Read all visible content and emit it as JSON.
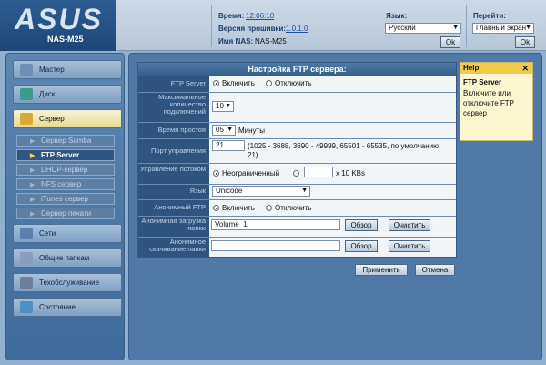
{
  "header": {
    "logo": "ASUS",
    "model": "NAS-M25",
    "time_label": "Время:",
    "time_value": "12:06:10",
    "firmware_label": "Версия прошивки:",
    "firmware_value": "1.0.1.0",
    "nas_name_label": "Имя NAS:",
    "nas_name_value": "NAS-M25",
    "language_label": "Язык:",
    "language_value": "Русский",
    "goto_label": "Перейти:",
    "goto_value": "Главный экран",
    "ok_label": "Ok"
  },
  "nav": {
    "items": [
      {
        "label": "Мастер",
        "icon": "wand-icon"
      },
      {
        "label": "Диск",
        "icon": "disk-icon"
      },
      {
        "label": "Сервер",
        "icon": "server-icon"
      },
      {
        "label": "Сети",
        "icon": "network-icon"
      },
      {
        "label": "Общие папкам",
        "icon": "share-icon"
      },
      {
        "label": "Техобслуживание",
        "icon": "tools-icon"
      },
      {
        "label": "Состояние",
        "icon": "status-icon"
      }
    ],
    "subitems": [
      "Сервер Samba",
      "FTP Server",
      "DHCP-сервер",
      "NFS сервер",
      "iTunes сервер",
      "Сервер печати"
    ]
  },
  "panel": {
    "title": "Настройка FTP сервера:",
    "rows": {
      "ftp_server_label": "FTP Server",
      "enable": "Включить",
      "disable": "Отключить",
      "max_conn_label": "Максимальное количество подключений",
      "max_conn_value": "10",
      "idle_label": "Время простоя",
      "idle_value": "05",
      "idle_unit": "Минуты",
      "port_label": "Порт управления",
      "port_value": "21",
      "port_hint": "(1025 - 3688, 3690 - 49999, 65501 - 65535, по умолчанию: 21)",
      "flow_label": "Управление потоком",
      "flow_unlimited": "Неограниченный",
      "flow_unit": "x 10 KBs",
      "lang_label": "Язык",
      "lang_value": "Unicode",
      "anon_label": "Анонимный FTP",
      "anon_up_label": "Анонимная загрузка папки",
      "anon_up_value": "Volume_1",
      "anon_down_label": "Анонимное скачивание папки",
      "anon_down_value": "",
      "browse": "Обзор",
      "clear": "Очистить"
    },
    "apply": "Применить",
    "cancel": "Отмена"
  },
  "help": {
    "header": "Help",
    "title": "FTP Server",
    "body": "Включите или отключите FTP сервер"
  }
}
